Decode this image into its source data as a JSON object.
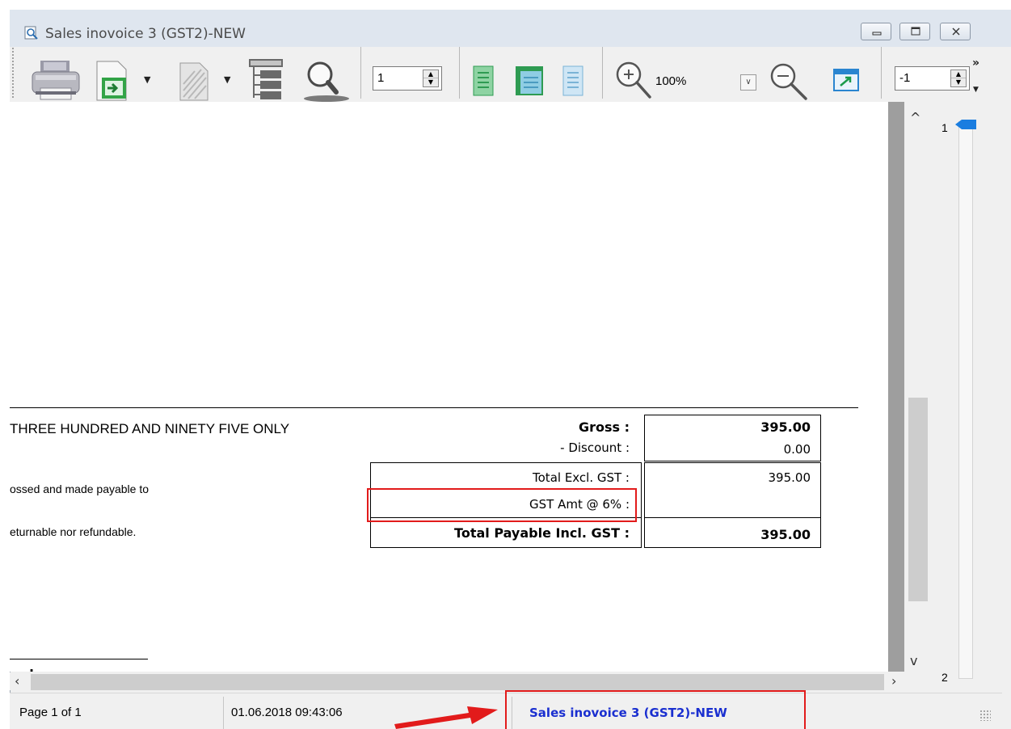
{
  "window": {
    "title": "Sales inovoice 3 (GST2)-NEW",
    "controls": [
      "minimize",
      "maximize",
      "close"
    ]
  },
  "toolbar": {
    "icons": [
      "printer-icon",
      "export-icon",
      "blank-page-icon",
      "outline-icon",
      "search-icon",
      "single-page-icon",
      "two-pages-icon",
      "multiple-pages-icon",
      "zoom-in-icon",
      "zoom-out-icon",
      "fit-window-icon"
    ],
    "page_value": "1",
    "zoom_label": "100%",
    "offset_value": "-1",
    "overflow_label": "»"
  },
  "report": {
    "amount_words": "THREE HUNDRED AND NINETY FIVE ONLY",
    "note_line_1": "ossed and made payable to",
    "note_line_2": "eturnable nor refundable.",
    "summary": [
      {
        "label": "Gross :",
        "value": "395.00",
        "bold": true
      },
      {
        "label": "- Discount :",
        "value": "0.00",
        "bold": false
      },
      {
        "label": "Total Excl. GST :",
        "value": "395.00",
        "bold": false
      },
      {
        "label": "GST Amt @ 6% :",
        "value": "",
        "bold": false
      },
      {
        "label": "Total Payable Incl. GST :",
        "value": "395.00",
        "bold": true
      }
    ],
    "signature_dot": "."
  },
  "pages_panel": {
    "first": "1",
    "last": "2"
  },
  "status": {
    "page_info": "Page 1 of 1",
    "timestamp": "01.06.2018 09:43:06",
    "report_title": "Sales inovoice 3 (GST2)-NEW"
  },
  "colors": {
    "highlight": "#e21b1b",
    "status_title": "#1a2fd0",
    "page_marker": "#1a7de0"
  }
}
